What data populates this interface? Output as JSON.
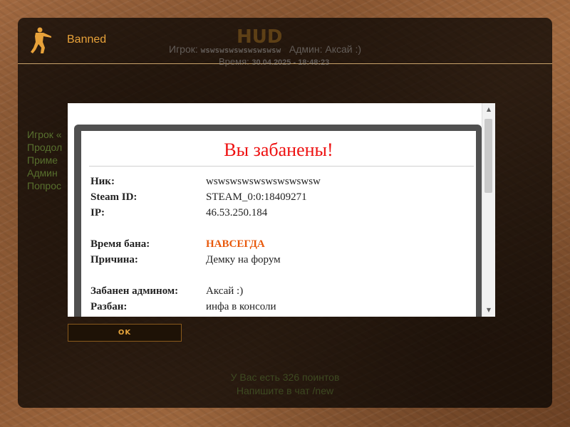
{
  "window": {
    "title": "Banned"
  },
  "background": {
    "logo_text": "HUD",
    "player_label": "Игрок:",
    "player_value": "wswswswswswswswsw",
    "admin_label": "Админ:",
    "admin_value": "Аксай :)",
    "time_label": "Время:",
    "time_value": "30.04.2025 - 18:48:23",
    "side_lines": [
      "Игрок «",
      "Продол",
      "Приме",
      "Админ",
      "Попрос"
    ],
    "points_line": "У Вас есть 326 поинтов",
    "chat_line": "Напишите в чат /new"
  },
  "ban": {
    "heading": "Вы забанены!",
    "rows": [
      {
        "label": "Ник:",
        "value": "wswswswswswswswswsw"
      },
      {
        "label": "Steam ID:",
        "value": "STEAM_0:0:18409271"
      },
      {
        "label": "IP:",
        "value": "46.53.250.184"
      },
      {
        "label": "Время бана:",
        "value": "НАВСЕГДА"
      },
      {
        "label": "Причина:",
        "value": "Демку на форум"
      },
      {
        "label": "Забанен админом:",
        "value": "Аксай :)"
      },
      {
        "label": "Разбан:",
        "value": "инфа в консоли"
      }
    ]
  },
  "colors": {
    "accent": "#e8a23a",
    "ban_title": "#ee1111",
    "duration_highlight": "#e8590c"
  },
  "buttons": {
    "ok_label": "OK"
  }
}
